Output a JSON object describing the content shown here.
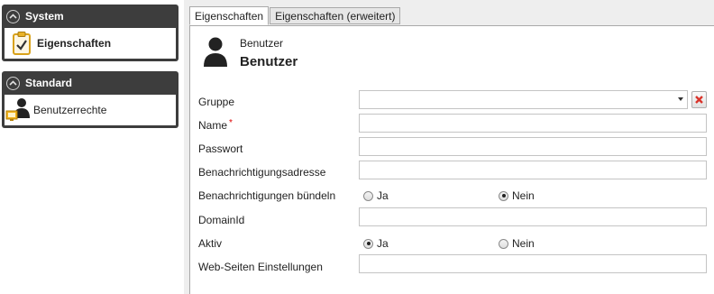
{
  "sidebar": {
    "groups": [
      {
        "title": "System",
        "items": [
          {
            "label": "Eigenschaften",
            "icon": "clipboard-check-icon"
          }
        ]
      },
      {
        "title": "Standard",
        "items": [
          {
            "label": "Benutzerrechte",
            "icon": "user-monitor-icon"
          }
        ]
      }
    ]
  },
  "tabs": [
    {
      "label": "Eigenschaften"
    },
    {
      "label": "Eigenschaften (erweitert)"
    }
  ],
  "header": {
    "small": "Benutzer",
    "title": "Benutzer"
  },
  "form": {
    "gruppe": {
      "label": "Gruppe",
      "value": ""
    },
    "name": {
      "label": "Name",
      "required_mark": "*",
      "value": ""
    },
    "passwort": {
      "label": "Passwort",
      "value": ""
    },
    "benachrichtigungsadresse": {
      "label": "Benachrichtigungsadresse",
      "value": ""
    },
    "buendeln": {
      "label": "Benachrichtigungen bündeln",
      "options": [
        "Ja",
        "Nein"
      ],
      "selected": "Nein"
    },
    "domainid": {
      "label": "DomainId",
      "value": ""
    },
    "aktiv": {
      "label": "Aktiv",
      "options": [
        "Ja",
        "Nein"
      ],
      "selected": "Ja"
    },
    "web": {
      "label": "Web-Seiten Einstellungen",
      "value": ""
    }
  },
  "colors": {
    "sidebar_header": "#3d3d3d",
    "panel_bg": "#eeeeee",
    "clear_x": "#d9342b"
  }
}
